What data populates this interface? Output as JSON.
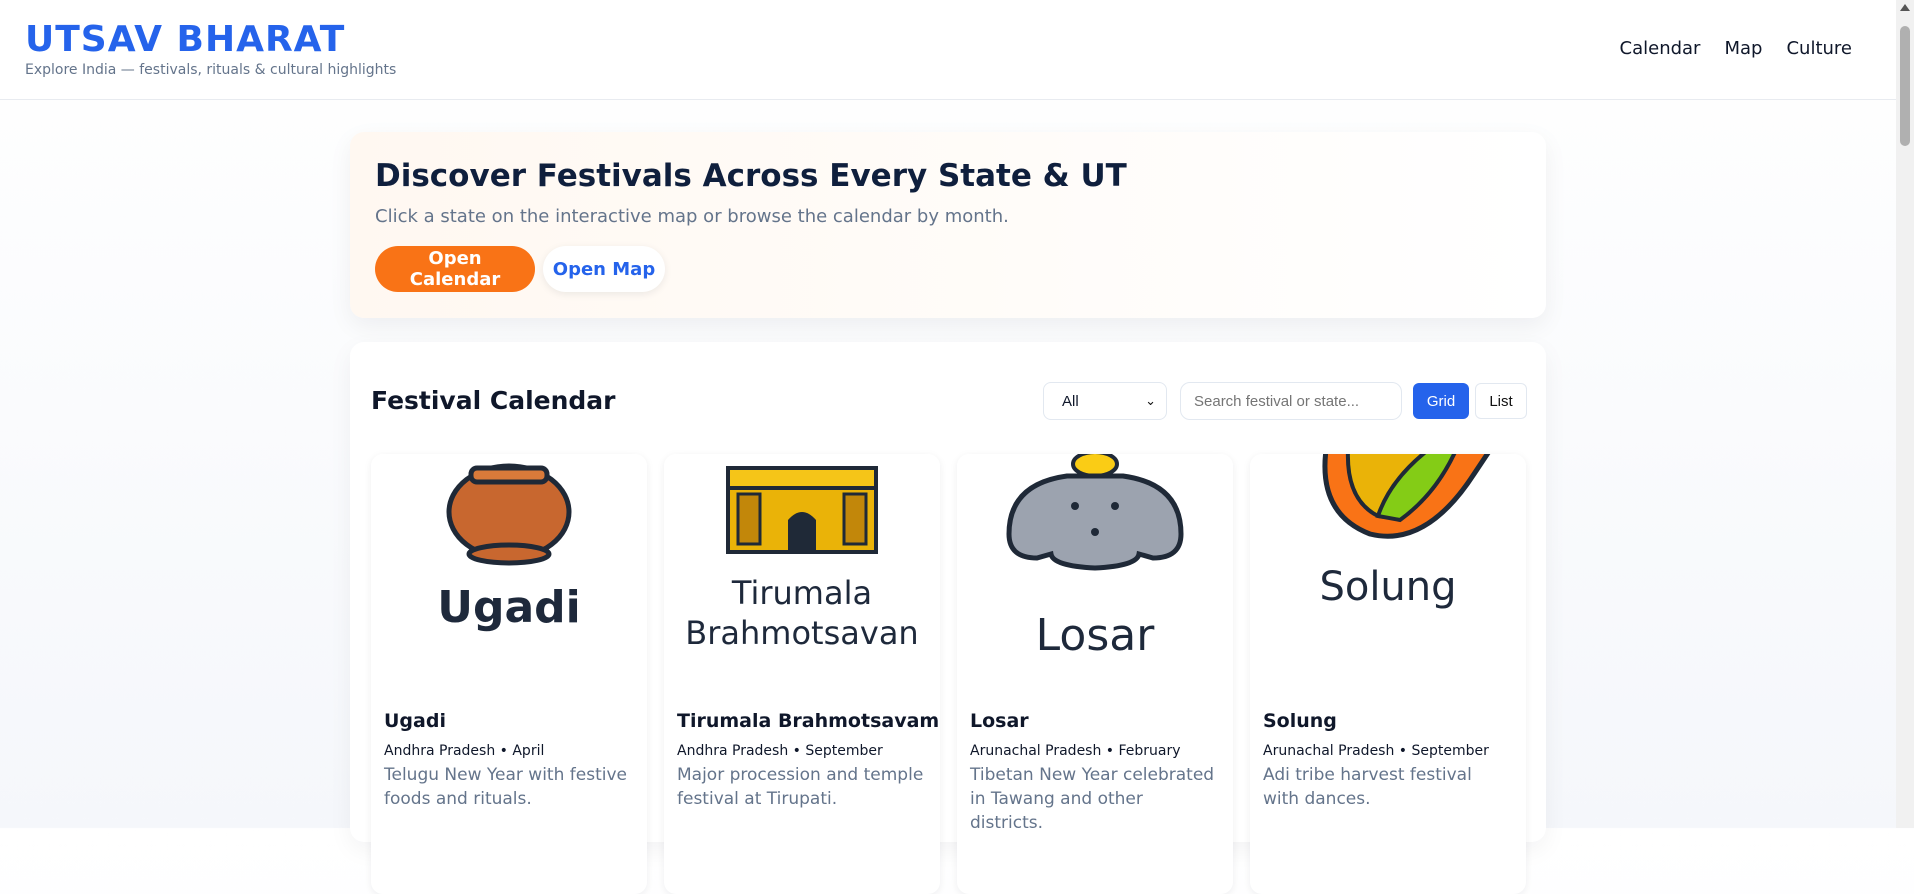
{
  "header": {
    "title": "UTSAV BHARAT",
    "subtitle": "Explore India — festivals, rituals & cultural highlights",
    "nav": [
      "Calendar",
      "Map",
      "Culture"
    ]
  },
  "hero": {
    "title": "Discover Festivals Across Every State & UT",
    "subtitle": "Click a state on the interactive map or browse the calendar by month.",
    "primary_button": "Open Calendar",
    "secondary_button": "Open Map"
  },
  "calendar": {
    "title": "Festival Calendar",
    "month_filter": "All",
    "search_placeholder": "Search festival or state...",
    "view_grid": "Grid",
    "view_list": "List"
  },
  "cards": [
    {
      "image_text": [
        "Ugadi"
      ],
      "name": "Ugadi",
      "meta": "Andhra Pradesh • April",
      "desc": "Telugu New Year with festive foods and rituals."
    },
    {
      "image_text": [
        "Tirumala",
        "Brahmotsavan"
      ],
      "name": "Tirumala Brahmotsavam",
      "meta": "Andhra Pradesh • September",
      "desc": "Major procession and temple festival at Tirupati."
    },
    {
      "image_text": [
        "Losar"
      ],
      "name": "Losar",
      "meta": "Arunachal Pradesh • February",
      "desc": "Tibetan New Year celebrated in Tawang and other districts."
    },
    {
      "image_text": [
        "Solung"
      ],
      "name": "Solung",
      "meta": "Arunachal Pradesh • September",
      "desc": "Adi tribe harvest festival with dances."
    }
  ],
  "colors": {
    "brand": "#2563eb",
    "accent": "#f97316",
    "muted": "#64748b"
  }
}
